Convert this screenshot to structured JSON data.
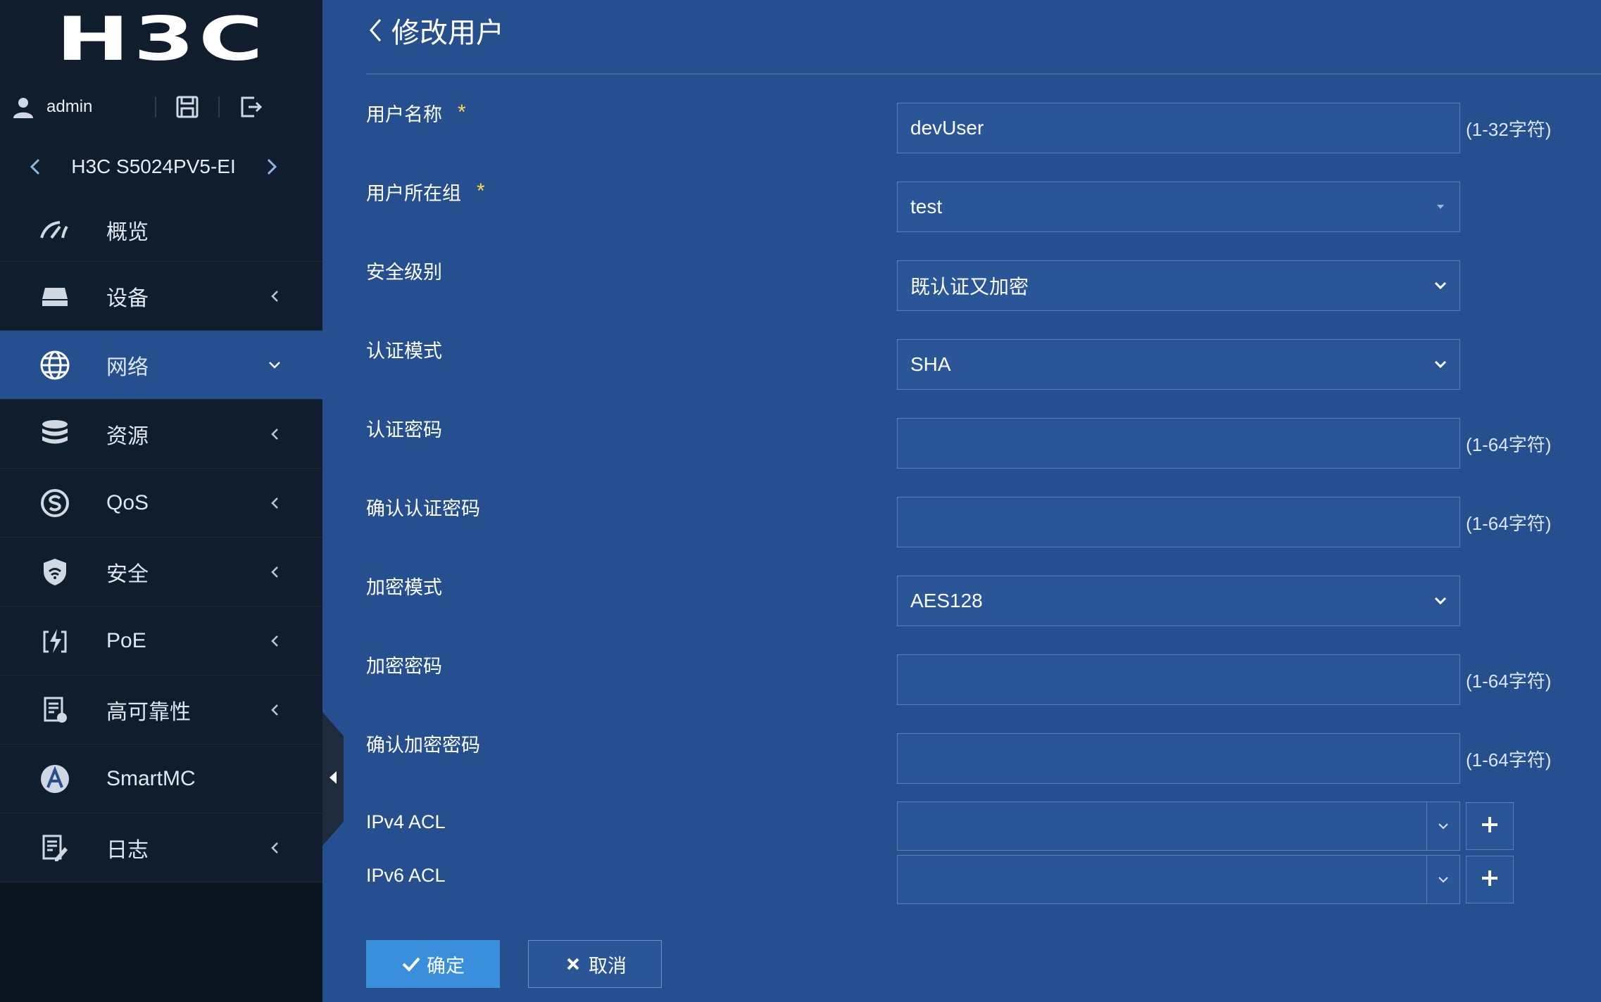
{
  "brand": {
    "logo_text": "H3C"
  },
  "user": {
    "name": "admin"
  },
  "device": {
    "name": "H3C S5024PV5-EI"
  },
  "menu": [
    {
      "label": "概览",
      "icon": "gauge-icon",
      "has_arrow": false
    },
    {
      "label": "设备",
      "icon": "device-icon",
      "has_arrow": true
    },
    {
      "label": "网络",
      "icon": "globe-icon",
      "has_arrow": true,
      "active": true
    },
    {
      "label": "资源",
      "icon": "database-icon",
      "has_arrow": true
    },
    {
      "label": "QoS",
      "icon": "qos-icon",
      "has_arrow": true
    },
    {
      "label": "安全",
      "icon": "shield-icon",
      "has_arrow": true
    },
    {
      "label": "PoE",
      "icon": "poe-icon",
      "has_arrow": true
    },
    {
      "label": "高可靠性",
      "icon": "reliability-icon",
      "has_arrow": true
    },
    {
      "label": "SmartMC",
      "icon": "smartmc-icon",
      "has_arrow": false
    },
    {
      "label": "日志",
      "icon": "log-icon",
      "has_arrow": true
    }
  ],
  "page": {
    "title": "修改用户"
  },
  "form": {
    "username": {
      "label": "用户名称",
      "required": "*",
      "value": "devUser",
      "hint": "(1-32字符)"
    },
    "group": {
      "label": "用户所在组",
      "required": "*",
      "value": "test"
    },
    "security_level": {
      "label": "安全级别",
      "value": "既认证又加密"
    },
    "auth_mode": {
      "label": "认证模式",
      "value": "SHA"
    },
    "auth_password": {
      "label": "认证密码",
      "value": "",
      "hint": "(1-64字符)"
    },
    "auth_password_confirm": {
      "label": "确认认证密码",
      "value": "",
      "hint": "(1-64字符)"
    },
    "encrypt_mode": {
      "label": "加密模式",
      "value": "AES128"
    },
    "encrypt_password": {
      "label": "加密密码",
      "value": "",
      "hint": "(1-64字符)"
    },
    "encrypt_password_confirm": {
      "label": "确认加密密码",
      "value": "",
      "hint": "(1-64字符)"
    },
    "ipv4_acl": {
      "label": "IPv4 ACL",
      "value": ""
    },
    "ipv6_acl": {
      "label": "IPv6 ACL",
      "value": ""
    }
  },
  "actions": {
    "ok_label": "确定",
    "cancel_label": "取消"
  },
  "colors": {
    "sidebar_bg": "#0f1d2c",
    "main_bg": "#254f8e",
    "accent": "#3a8fdd",
    "required_star": "#ffd54a"
  }
}
